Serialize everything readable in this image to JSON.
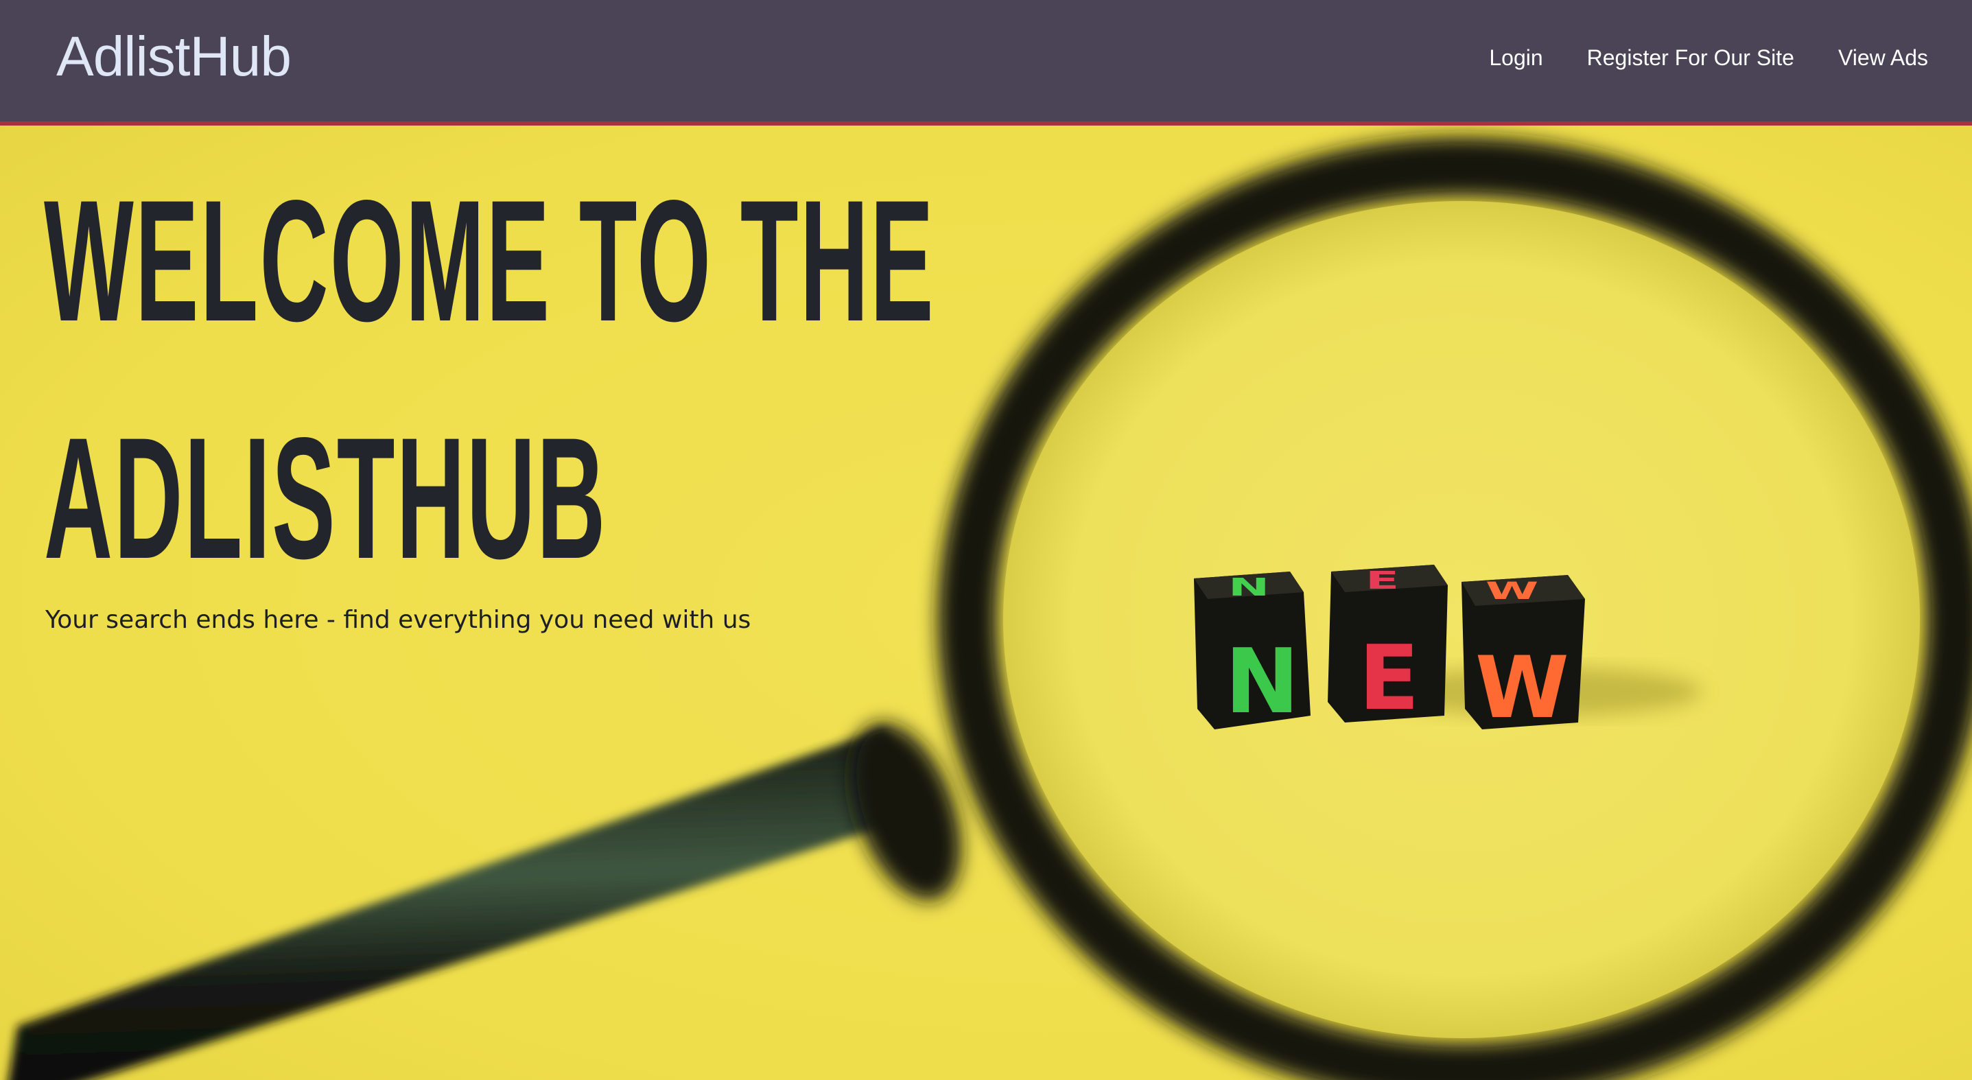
{
  "navbar": {
    "brand": "AdlistHub",
    "links": [
      {
        "label": "Login"
      },
      {
        "label": "Register For Our Site"
      },
      {
        "label": "View Ads"
      }
    ],
    "background": "#4a4456",
    "accent_border": "#a8323a"
  },
  "hero": {
    "title_line1": "WELCOME TO THE",
    "title_line2": "ADLISTHUB",
    "subtitle": "Your search ends here - find everything you need with us",
    "background": "#efde4b",
    "image": {
      "description_icon": "magnifying-glass-over-new-dice",
      "dice": [
        {
          "letter": "N",
          "color": "#3bd24a"
        },
        {
          "letter": "E",
          "color": "#e5344a"
        },
        {
          "letter": "W",
          "color": "#ff6a33"
        }
      ]
    }
  }
}
